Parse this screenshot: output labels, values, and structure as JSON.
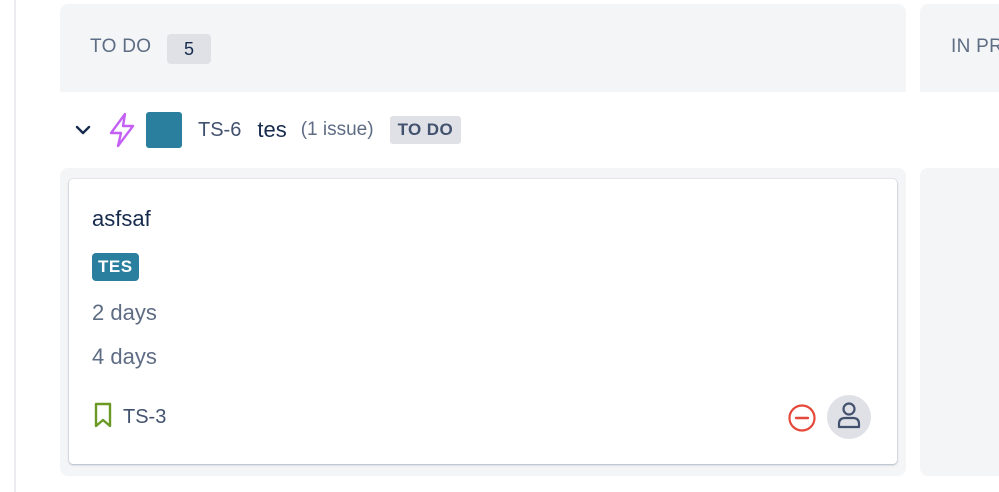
{
  "columns": [
    {
      "title": "TO DO",
      "count": "5"
    },
    {
      "title": "IN PR"
    }
  ],
  "swimlane": {
    "key": "TS-6",
    "name": "tes",
    "issue_count": "(1 issue)",
    "status": "TO DO",
    "icons": {
      "type": "lightning-icon",
      "epic_color": "#2a7f9e"
    }
  },
  "card": {
    "summary": "asfsaf",
    "epic_label": "TES",
    "estimates": [
      "2 days",
      "4 days"
    ],
    "key": "TS-3",
    "icons": {
      "issue_type": "bookmark-icon",
      "priority": "minus-circle-icon",
      "assignee": "user-icon"
    }
  },
  "colors": {
    "epic": "#2a7f9e",
    "lightning": "#c560f5",
    "bookmark": "#6a9a23",
    "priority": "#e5493a"
  }
}
